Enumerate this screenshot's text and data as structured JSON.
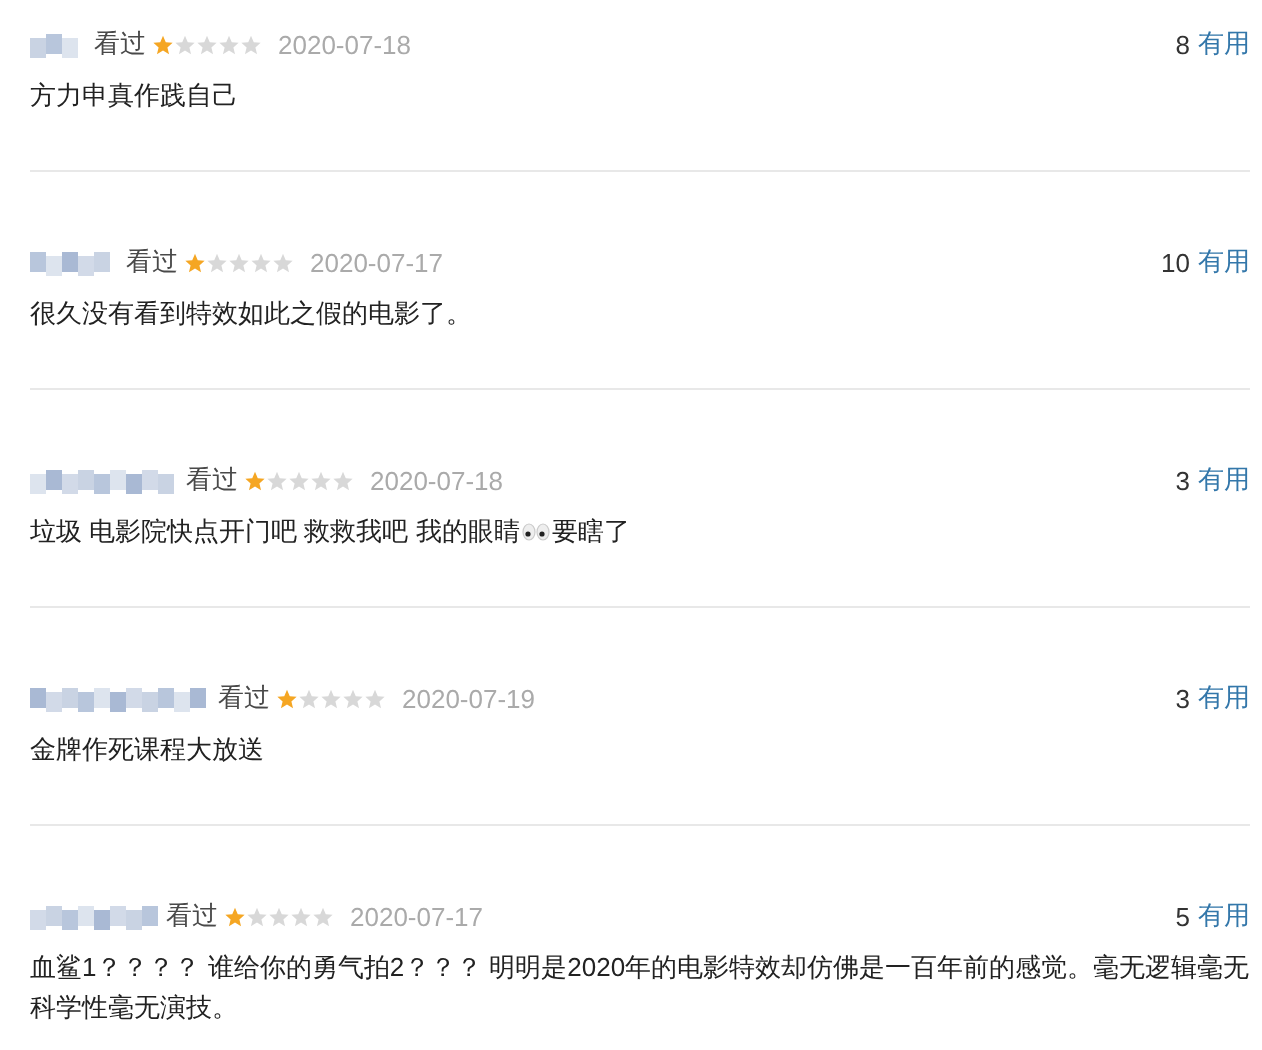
{
  "reviews": [
    {
      "status": "看过",
      "stars": 1,
      "date": "2020-07-18",
      "votes": "8",
      "useful": "有用",
      "comment_parts": [
        "方力申真作践自己"
      ]
    },
    {
      "status": "看过",
      "stars": 1,
      "date": "2020-07-17",
      "votes": "10",
      "useful": "有用",
      "comment_parts": [
        "很久没有看到特效如此之假的电影了。"
      ]
    },
    {
      "status": "看过",
      "stars": 1,
      "date": "2020-07-18",
      "votes": "3",
      "useful": "有用",
      "comment_parts": [
        "垃圾 电影院快点开门吧 救救我吧 我的眼睛",
        "要瞎了"
      ]
    },
    {
      "status": "看过",
      "stars": 1,
      "date": "2020-07-19",
      "votes": "3",
      "useful": "有用",
      "comment_parts": [
        "金牌作死课程大放送"
      ]
    },
    {
      "status": "看过",
      "stars": 1,
      "date": "2020-07-17",
      "votes": "5",
      "useful": "有用",
      "comment_parts": [
        "血鲨1？？？？ 谁给你的勇气拍2？？？  明明是2020年的电影特效却仿佛是一百年前的感觉。毫无逻辑毫无科学性毫无演技。"
      ]
    }
  ]
}
